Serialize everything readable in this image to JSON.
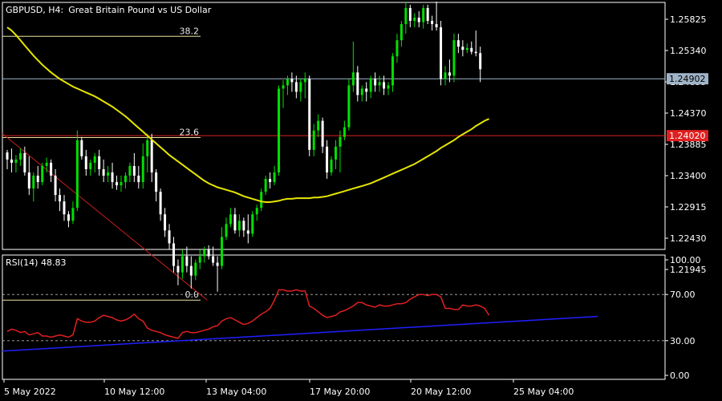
{
  "header": {
    "symbol_timeframe": "GBPUSD, H4:",
    "description": "Great Britain Pound vs US Dollar"
  },
  "colors": {
    "background": "#000000",
    "frame": "#ffffff",
    "bull_candle": "#00e000",
    "bear_candle": "#ffffff",
    "moving_average": "#e6e600",
    "fib_lines": "#e6e6a0",
    "trend_line_main": "#c81e1e",
    "price_line": "#a0b4c8",
    "horizontal_line": "#e02020",
    "rsi_line": "#e02020",
    "rsi_trend": "#2020ff",
    "rsi_levels": "#b4b4b4"
  },
  "chart_data": [
    {
      "type": "candlestick",
      "y_ticks": [
        "1.25825",
        "1.25340",
        "1.24855",
        "1.24370",
        "1.23885",
        "1.23400",
        "1.22915",
        "1.22430",
        "1.21945"
      ],
      "ylim": [
        1.2147,
        1.2628
      ],
      "x_ticks": [
        "5 May 2022",
        "10 May 12:00",
        "13 May 04:00",
        "17 May 20:00",
        "20 May 12:00",
        "25 May 04:00"
      ],
      "current_price_label": "1.24902",
      "horizontal_line_label": "1.24020",
      "fibonacci_levels": [
        {
          "label": "38.2",
          "price": 1.2556
        },
        {
          "label": "23.6",
          "price": 1.2399
        },
        {
          "label": "0.0",
          "price": 1.2147
        }
      ],
      "candles": [
        [
          1.2376,
          1.238,
          1.235,
          1.2365
        ],
        [
          1.2365,
          1.2382,
          1.2345,
          1.236
        ],
        [
          1.236,
          1.2372,
          1.2345,
          1.2365
        ],
        [
          1.2365,
          1.2382,
          1.2355,
          1.2375
        ],
        [
          1.2375,
          1.2385,
          1.234,
          1.2345
        ],
        [
          1.2345,
          1.237,
          1.231,
          1.232
        ],
        [
          1.232,
          1.2345,
          1.23,
          1.234
        ],
        [
          1.234,
          1.2355,
          1.232,
          1.233
        ],
        [
          1.233,
          1.236,
          1.2325,
          1.2355
        ],
        [
          1.2355,
          1.2368,
          1.2345,
          1.236
        ],
        [
          1.236,
          1.2365,
          1.233,
          1.234
        ],
        [
          1.234,
          1.235,
          1.23,
          1.231
        ],
        [
          1.231,
          1.232,
          1.2285,
          1.23
        ],
        [
          1.23,
          1.231,
          1.227,
          1.228
        ],
        [
          1.228,
          1.2285,
          1.226,
          1.227
        ],
        [
          1.227,
          1.23,
          1.2265,
          1.229
        ],
        [
          1.229,
          1.241,
          1.2285,
          1.2395
        ],
        [
          1.2395,
          1.24,
          1.2365,
          1.237
        ],
        [
          1.237,
          1.238,
          1.234,
          1.235
        ],
        [
          1.235,
          1.2365,
          1.234,
          1.236
        ],
        [
          1.236,
          1.2375,
          1.2345,
          1.237
        ],
        [
          1.237,
          1.238,
          1.234,
          1.235
        ],
        [
          1.235,
          1.2365,
          1.233,
          1.234
        ],
        [
          1.234,
          1.2355,
          1.233,
          1.2345
        ],
        [
          1.2345,
          1.236,
          1.232,
          1.233
        ],
        [
          1.233,
          1.234,
          1.2318,
          1.2325
        ],
        [
          1.2325,
          1.234,
          1.2315,
          1.233
        ],
        [
          1.233,
          1.2345,
          1.232,
          1.234
        ],
        [
          1.234,
          1.236,
          1.233,
          1.2355
        ],
        [
          1.2355,
          1.2375,
          1.233,
          1.234
        ],
        [
          1.234,
          1.2355,
          1.232,
          1.233
        ],
        [
          1.233,
          1.239,
          1.232,
          1.237
        ],
        [
          1.237,
          1.2405,
          1.2345,
          1.2395
        ],
        [
          1.2395,
          1.2405,
          1.233,
          1.2345
        ],
        [
          1.2345,
          1.235,
          1.23,
          1.2315
        ],
        [
          1.2315,
          1.232,
          1.227,
          1.228
        ],
        [
          1.228,
          1.229,
          1.2245,
          1.2255
        ],
        [
          1.2255,
          1.2265,
          1.2225,
          1.2235
        ],
        [
          1.2235,
          1.2245,
          1.219,
          1.22
        ],
        [
          1.22,
          1.221,
          1.217,
          1.219
        ],
        [
          1.219,
          1.2225,
          1.218,
          1.2215
        ],
        [
          1.2215,
          1.223,
          1.219,
          1.22
        ],
        [
          1.22,
          1.2215,
          1.2165,
          1.2185
        ],
        [
          1.2185,
          1.221,
          1.2178,
          1.2205
        ],
        [
          1.2205,
          1.2225,
          1.2195,
          1.2215
        ],
        [
          1.2215,
          1.223,
          1.2205,
          1.2225
        ],
        [
          1.2225,
          1.2232,
          1.221,
          1.2215
        ],
        [
          1.2215,
          1.223,
          1.22,
          1.2205
        ],
        [
          1.2205,
          1.2215,
          1.216,
          1.22
        ],
        [
          1.22,
          1.226,
          1.2195,
          1.2245
        ],
        [
          1.2245,
          1.2275,
          1.224,
          1.2265
        ],
        [
          1.2265,
          1.229,
          1.226,
          1.228
        ],
        [
          1.228,
          1.229,
          1.225,
          1.2255
        ],
        [
          1.2255,
          1.228,
          1.2245,
          1.227
        ],
        [
          1.227,
          1.2275,
          1.2245,
          1.2255
        ],
        [
          1.2255,
          1.228,
          1.2235,
          1.225
        ],
        [
          1.225,
          1.2285,
          1.2245,
          1.228
        ],
        [
          1.228,
          1.2295,
          1.227,
          1.229
        ],
        [
          1.229,
          1.232,
          1.2285,
          1.2315
        ],
        [
          1.2315,
          1.234,
          1.231,
          1.2335
        ],
        [
          1.2335,
          1.2345,
          1.232,
          1.233
        ],
        [
          1.233,
          1.2355,
          1.2325,
          1.2345
        ],
        [
          1.2345,
          1.248,
          1.234,
          1.2475
        ],
        [
          1.2475,
          1.2488,
          1.2445,
          1.248
        ],
        [
          1.248,
          1.2495,
          1.2465,
          1.249
        ],
        [
          1.249,
          1.25,
          1.247,
          1.2485
        ],
        [
          1.2485,
          1.2495,
          1.246,
          1.247
        ],
        [
          1.247,
          1.249,
          1.2455,
          1.2485
        ],
        [
          1.2485,
          1.25,
          1.246,
          1.249
        ],
        [
          1.249,
          1.2495,
          1.237,
          1.238
        ],
        [
          1.238,
          1.242,
          1.237,
          1.241
        ],
        [
          1.241,
          1.2435,
          1.24,
          1.2425
        ],
        [
          1.2425,
          1.243,
          1.2375,
          1.2385
        ],
        [
          1.2385,
          1.2395,
          1.2335,
          1.2345
        ],
        [
          1.2345,
          1.237,
          1.234,
          1.2365
        ],
        [
          1.2365,
          1.2395,
          1.235,
          1.2385
        ],
        [
          1.2385,
          1.241,
          1.2345,
          1.24
        ],
        [
          1.24,
          1.2425,
          1.2395,
          1.2415
        ],
        [
          1.2415,
          1.249,
          1.241,
          1.248
        ],
        [
          1.248,
          1.2548,
          1.247,
          1.25
        ],
        [
          1.25,
          1.251,
          1.2455,
          1.2465
        ],
        [
          1.2465,
          1.248,
          1.2455,
          1.2475
        ],
        [
          1.2475,
          1.2485,
          1.2455,
          1.247
        ],
        [
          1.247,
          1.2495,
          1.246,
          1.249
        ],
        [
          1.249,
          1.25,
          1.247,
          1.248
        ],
        [
          1.248,
          1.2495,
          1.247,
          1.2485
        ],
        [
          1.2485,
          1.2495,
          1.2465,
          1.2475
        ],
        [
          1.2475,
          1.2485,
          1.2465,
          1.248
        ],
        [
          1.248,
          1.253,
          1.247,
          1.2525
        ],
        [
          1.2525,
          1.256,
          1.2515,
          1.255
        ],
        [
          1.255,
          1.258,
          1.254,
          1.2575
        ],
        [
          1.2575,
          1.261,
          1.256,
          1.26
        ],
        [
          1.26,
          1.2605,
          1.257,
          1.258
        ],
        [
          1.258,
          1.2592,
          1.257,
          1.2585
        ],
        [
          1.2585,
          1.2595,
          1.257,
          1.2578
        ],
        [
          1.2578,
          1.2605,
          1.2568,
          1.26
        ],
        [
          1.26,
          1.2605,
          1.2575,
          1.258
        ],
        [
          1.258,
          1.2588,
          1.2565,
          1.2575
        ],
        [
          1.2575,
          1.261,
          1.2565,
          1.257
        ],
        [
          1.257,
          1.258,
          1.248,
          1.249
        ],
        [
          1.249,
          1.251,
          1.248,
          1.25
        ],
        [
          1.25,
          1.252,
          1.2485,
          1.2495
        ],
        [
          1.2495,
          1.256,
          1.2485,
          1.255
        ],
        [
          1.255,
          1.256,
          1.253,
          1.254
        ],
        [
          1.254,
          1.255,
          1.2525,
          1.2535
        ],
        [
          1.2535,
          1.2545,
          1.253,
          1.2538
        ],
        [
          1.2538,
          1.2548,
          1.2528,
          1.2532
        ],
        [
          1.2532,
          1.2565,
          1.2525,
          1.253
        ],
        [
          1.253,
          1.254,
          1.2485,
          1.2505
        ]
      ],
      "moving_average": [
        1.257,
        1.2565,
        1.2558,
        1.255,
        1.2542,
        1.2534,
        1.2526,
        1.2519,
        1.2512,
        1.2506,
        1.25,
        1.2495,
        1.249,
        1.2486,
        1.2482,
        1.2478,
        1.2475,
        1.2472,
        1.2469,
        1.2466,
        1.2463,
        1.2459,
        1.2455,
        1.2451,
        1.2447,
        1.2442,
        1.2437,
        1.2432,
        1.2426,
        1.242,
        1.2414,
        1.2408,
        1.2402,
        1.2396,
        1.239,
        1.2384,
        1.2378,
        1.2372,
        1.2367,
        1.2362,
        1.2357,
        1.2352,
        1.2347,
        1.2342,
        1.2337,
        1.2332,
        1.2328,
        1.2325,
        1.2322,
        1.232,
        1.2318,
        1.2316,
        1.2314,
        1.2311,
        1.2308,
        1.2306,
        1.2304,
        1.2302,
        1.23,
        1.2299,
        1.2299,
        1.23,
        1.2301,
        1.2303,
        1.2304,
        1.2304,
        1.2305,
        1.2305,
        1.2305,
        1.2305,
        1.2306,
        1.2306,
        1.2307,
        1.2308,
        1.231,
        1.2312,
        1.2314,
        1.2316,
        1.2318,
        1.232,
        1.2322,
        1.2324,
        1.2326,
        1.2328,
        1.2331,
        1.2334,
        1.2337,
        1.234,
        1.2343,
        1.2346,
        1.2349,
        1.2352,
        1.2355,
        1.2358,
        1.2362,
        1.2366,
        1.237,
        1.2374,
        1.2378,
        1.2383,
        1.2387,
        1.2391,
        1.2395,
        1.24,
        1.2404,
        1.2408,
        1.2412,
        1.2417,
        1.2421,
        1.2425,
        1.2428
      ]
    },
    {
      "type": "line",
      "title": "RSI(14) 48.83",
      "y_ticks": [
        "100.00",
        "70.00",
        "30.00",
        "0.00"
      ],
      "ylim": [
        0,
        100
      ],
      "levels": [
        70,
        30
      ],
      "rsi_values": [
        38,
        40,
        39,
        37,
        38,
        35,
        36,
        37,
        34,
        34,
        33,
        34,
        35,
        34,
        33,
        35,
        49,
        47,
        46,
        46,
        47,
        50,
        52,
        51,
        50,
        48,
        47,
        48,
        50,
        53,
        49,
        47,
        41,
        39,
        38,
        37,
        35,
        34,
        33,
        32,
        37,
        38,
        37,
        37,
        38,
        39,
        40,
        42,
        43,
        47,
        49,
        50,
        48,
        46,
        44,
        45,
        47,
        50,
        53,
        55,
        58,
        65,
        74,
        74,
        73,
        73,
        74,
        73,
        73,
        60,
        58,
        55,
        52,
        50,
        51,
        52,
        55,
        56,
        58,
        60,
        63,
        63,
        61,
        60,
        59,
        61,
        60,
        60,
        61,
        62,
        62,
        63,
        66,
        68,
        70,
        70,
        69,
        70,
        70,
        68,
        58,
        58,
        57,
        57,
        61,
        60,
        60,
        61,
        60,
        58,
        52
      ]
    }
  ]
}
